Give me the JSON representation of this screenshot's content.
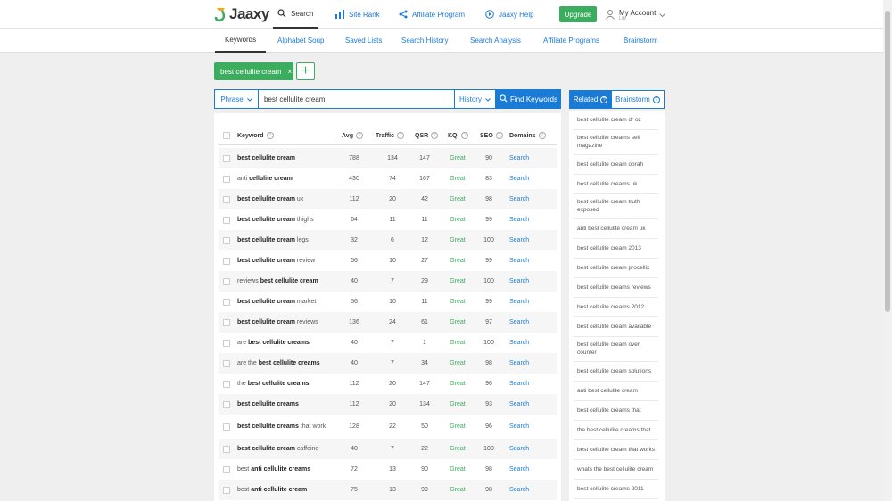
{
  "brand": {
    "name": "Jaaxy"
  },
  "topnav": {
    "search": "Search",
    "site_rank": "Site Rank",
    "affiliate_program": "Affiliate Program",
    "jaaxy_help": "Jaaxy Help",
    "upgrade": "Upgrade",
    "account_title": "My Account",
    "account_plan": "Lite"
  },
  "subnav": [
    "Keywords",
    "Alphabet Soup",
    "Saved Lists",
    "Search History",
    "Search Analysis",
    "Affiliate Programs",
    "Brainstorm"
  ],
  "tag": {
    "label": "best cellulite cream",
    "remove": "×",
    "add": "+"
  },
  "search": {
    "mode": "Phrase",
    "value": "best cellulite cream",
    "history": "History",
    "find": "Find Keywords"
  },
  "table": {
    "headers": {
      "keyword": "Keyword",
      "avg": "Avg",
      "traffic": "Traffic",
      "qsr": "QSR",
      "kqi": "KQI",
      "seo": "SEO",
      "domains": "Domains"
    },
    "rows": [
      {
        "pre": "",
        "bold": "best cellulite cream",
        "post": "",
        "avg": "788",
        "traffic": "134",
        "qsr": "147",
        "kqi": "Great",
        "seo": "90",
        "domains": "Search"
      },
      {
        "pre": "anti ",
        "bold": "cellulite cream",
        "post": "",
        "avg": "430",
        "traffic": "74",
        "qsr": "167",
        "kqi": "Great",
        "seo": "83",
        "domains": "Search"
      },
      {
        "pre": "",
        "bold": "best cellulite cream",
        "post": " uk",
        "avg": "112",
        "traffic": "20",
        "qsr": "42",
        "kqi": "Great",
        "seo": "98",
        "domains": "Search"
      },
      {
        "pre": "",
        "bold": "best cellulite cream",
        "post": " thighs",
        "avg": "64",
        "traffic": "11",
        "qsr": "11",
        "kqi": "Great",
        "seo": "99",
        "domains": "Search"
      },
      {
        "pre": "",
        "bold": "best cellulite cream",
        "post": " legs",
        "avg": "32",
        "traffic": "6",
        "qsr": "12",
        "kqi": "Great",
        "seo": "100",
        "domains": "Search"
      },
      {
        "pre": "",
        "bold": "best cellulite cream",
        "post": " review",
        "avg": "56",
        "traffic": "10",
        "qsr": "27",
        "kqi": "Great",
        "seo": "99",
        "domains": "Search"
      },
      {
        "pre": "reviews ",
        "bold": "best cellulite cream",
        "post": "",
        "avg": "40",
        "traffic": "7",
        "qsr": "29",
        "kqi": "Great",
        "seo": "100",
        "domains": "Search"
      },
      {
        "pre": "",
        "bold": "best cellulite cream",
        "post": " market",
        "avg": "56",
        "traffic": "10",
        "qsr": "11",
        "kqi": "Great",
        "seo": "99",
        "domains": "Search"
      },
      {
        "pre": "",
        "bold": "best cellulite cream",
        "post": " reviews",
        "avg": "136",
        "traffic": "24",
        "qsr": "61",
        "kqi": "Great",
        "seo": "97",
        "domains": "Search"
      },
      {
        "pre": "are ",
        "bold": "best cellulite creams",
        "post": "",
        "avg": "40",
        "traffic": "7",
        "qsr": "1",
        "kqi": "Great",
        "seo": "100",
        "domains": "Search"
      },
      {
        "pre": "are the ",
        "bold": "best cellulite creams",
        "post": "",
        "avg": "40",
        "traffic": "7",
        "qsr": "34",
        "kqi": "Great",
        "seo": "98",
        "domains": "Search"
      },
      {
        "pre": "the ",
        "bold": "best cellulite creams",
        "post": "",
        "avg": "112",
        "traffic": "20",
        "qsr": "147",
        "kqi": "Great",
        "seo": "96",
        "domains": "Search"
      },
      {
        "pre": "",
        "bold": "best cellulite creams",
        "post": "",
        "avg": "112",
        "traffic": "20",
        "qsr": "134",
        "kqi": "Great",
        "seo": "93",
        "domains": "Search"
      },
      {
        "pre": "",
        "bold": "best cellulite creams",
        "post": " that work",
        "avg": "128",
        "traffic": "22",
        "qsr": "50",
        "kqi": "Great",
        "seo": "96",
        "domains": "Search"
      },
      {
        "pre": "",
        "bold": "best cellulite cream",
        "post": " caffeine",
        "avg": "40",
        "traffic": "7",
        "qsr": "22",
        "kqi": "Great",
        "seo": "100",
        "domains": "Search"
      },
      {
        "pre": "best ",
        "bold": "anti cellulite creams",
        "post": "",
        "avg": "72",
        "traffic": "13",
        "qsr": "90",
        "kqi": "Great",
        "seo": "98",
        "domains": "Search"
      },
      {
        "pre": "best ",
        "bold": "anti cellulite cream",
        "post": "",
        "avg": "75",
        "traffic": "13",
        "qsr": "99",
        "kqi": "Great",
        "seo": "98",
        "domains": "Search"
      }
    ]
  },
  "related": {
    "tab_related": "Related",
    "tab_brainstorm": "Brainstorm",
    "items": [
      "best cellulite cream dr oz",
      "best cellulite creams self magazine",
      "best cellulite cream oprah",
      "best cellulite creams uk",
      "best cellulite cream truth exposed",
      "anti best cellulite cream uk",
      "best cellulite cream 2013",
      "best cellulite cream procellix",
      "best cellulite creams reviews",
      "best cellulite creams 2012",
      "best cellulite cream available",
      "best cellulite cream over counter",
      "best cellulite cream solutions",
      "anti best cellulite cream",
      "best cellulite creams that",
      "the best cellulite creams that",
      "best cellulite cream that works",
      "whats the best cellulite cream",
      "best cellulite creams 2011"
    ]
  },
  "colors": {
    "green": "#3cac5f",
    "blue": "#1a7bd6"
  },
  "icons": [
    "search-icon",
    "bar-chart-icon",
    "share-icon",
    "play-circle-icon",
    "user-icon",
    "chevron-down-icon",
    "info-icon"
  ]
}
